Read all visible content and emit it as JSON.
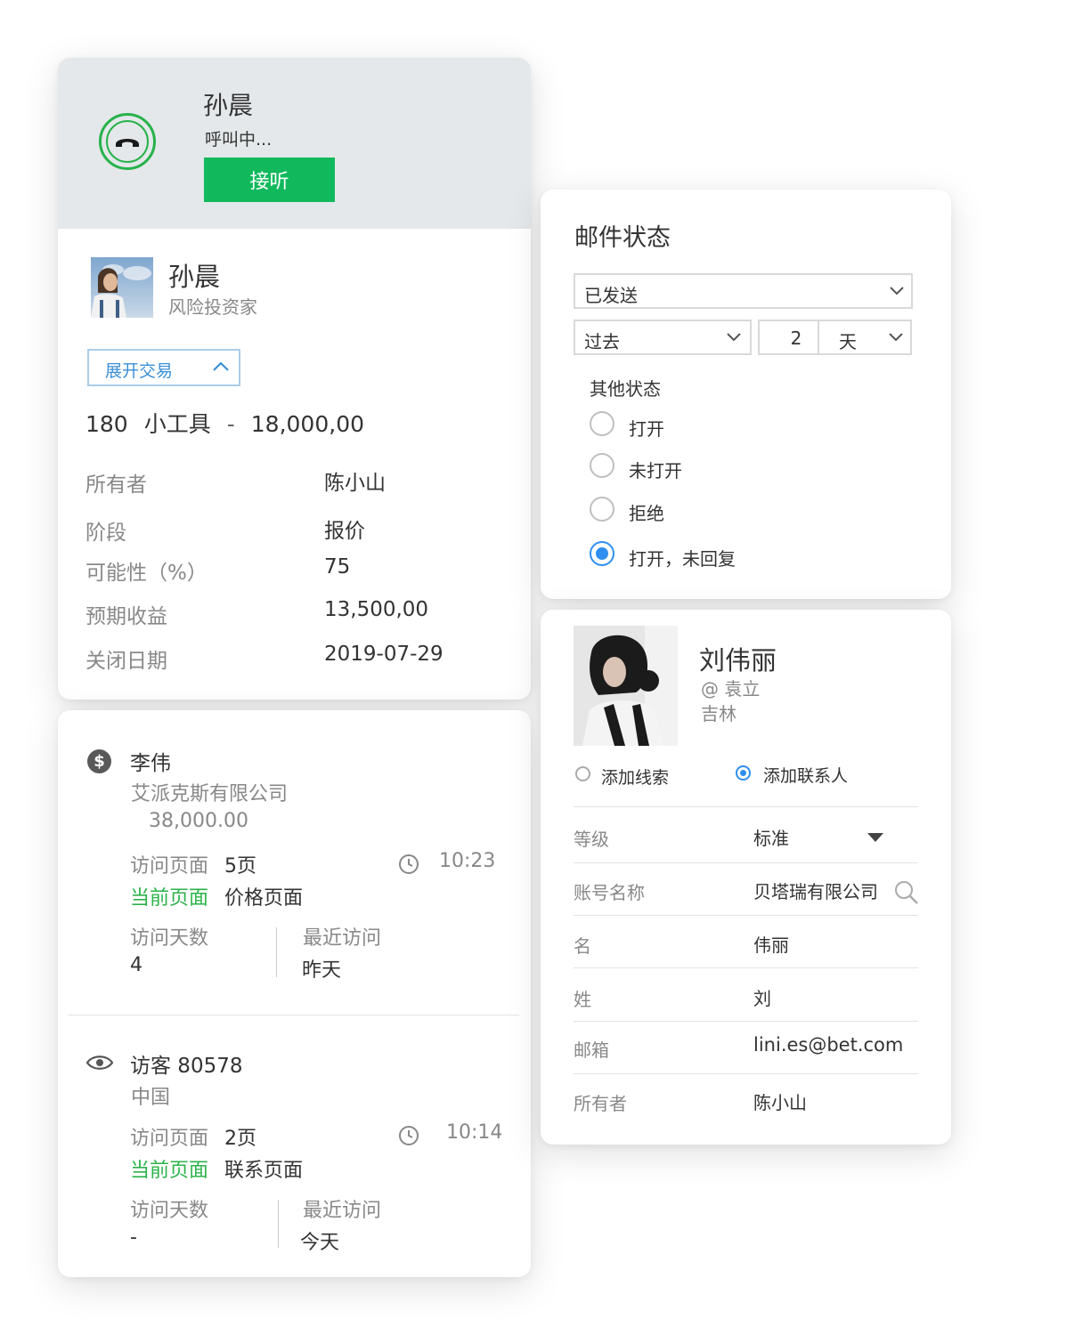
{
  "call": {
    "name": "孙晨",
    "status": "呼叫中...",
    "answer_label": "接听"
  },
  "deal": {
    "contact_name": "孙晨",
    "contact_title": "风险投资家",
    "expand_label": "展开交易",
    "quantity": "180",
    "product": "小工具",
    "dash": "-",
    "amount": "18,000,00",
    "fields": [
      {
        "label": "所有者",
        "value": "陈小山"
      },
      {
        "label": "阶段",
        "value": "报价"
      },
      {
        "label": "可能性（%）",
        "value": "75"
      },
      {
        "label": "预期收益",
        "value": "13,500,00"
      },
      {
        "label": "关闭日期",
        "value": "2019-07-29"
      }
    ]
  },
  "visitors": [
    {
      "icon": "dollar-icon",
      "name": "李伟",
      "company": "艾派克斯有限公司",
      "value": "38,000.00",
      "visited_label": "访问页面",
      "visited_pages": "5页",
      "time": "10:23",
      "current_label": "当前页面",
      "current_page": "价格页面",
      "days_label": "访问天数",
      "days_value": "4",
      "recent_label": "最近访问",
      "recent_value": "昨天"
    },
    {
      "icon": "eye-icon",
      "name": "访客 80578",
      "company": "中国",
      "visited_label": "访问页面",
      "visited_pages": "2页",
      "time": "10:14",
      "current_label": "当前页面",
      "current_page": "联系页面",
      "days_label": "访问天数",
      "days_value": "-",
      "recent_label": "最近访问",
      "recent_value": "今天"
    }
  ],
  "mail": {
    "title": "邮件状态",
    "status_select": "已发送",
    "period_select": "过去",
    "period_count": "2",
    "unit_select": "天",
    "other_label": "其他状态",
    "options": [
      {
        "label": "打开",
        "checked": false
      },
      {
        "label": "未打开",
        "checked": false
      },
      {
        "label": "拒绝",
        "checked": false
      },
      {
        "label": "打开，未回复",
        "checked": true
      }
    ]
  },
  "contact": {
    "name": "刘伟丽",
    "handle": "@ 袁立",
    "location": "吉林",
    "add_lead": "添加线索",
    "add_contact": "添加联系人",
    "add_contact_selected": true,
    "fields": [
      {
        "label": "等级",
        "value": "标准"
      },
      {
        "label": "账号名称",
        "value": "贝塔瑞有限公司"
      },
      {
        "label": "名",
        "value": "伟丽"
      },
      {
        "label": "姓",
        "value": "刘"
      },
      {
        "label": "邮箱",
        "value": "lini.es@bet.com"
      },
      {
        "label": "所有者",
        "value": "陈小山"
      }
    ]
  },
  "colors": {
    "accent_green": "#12b95c",
    "link_blue": "#3b8fd6",
    "radio_blue": "#2f8ff0",
    "current_page_green": "#2db34a"
  }
}
